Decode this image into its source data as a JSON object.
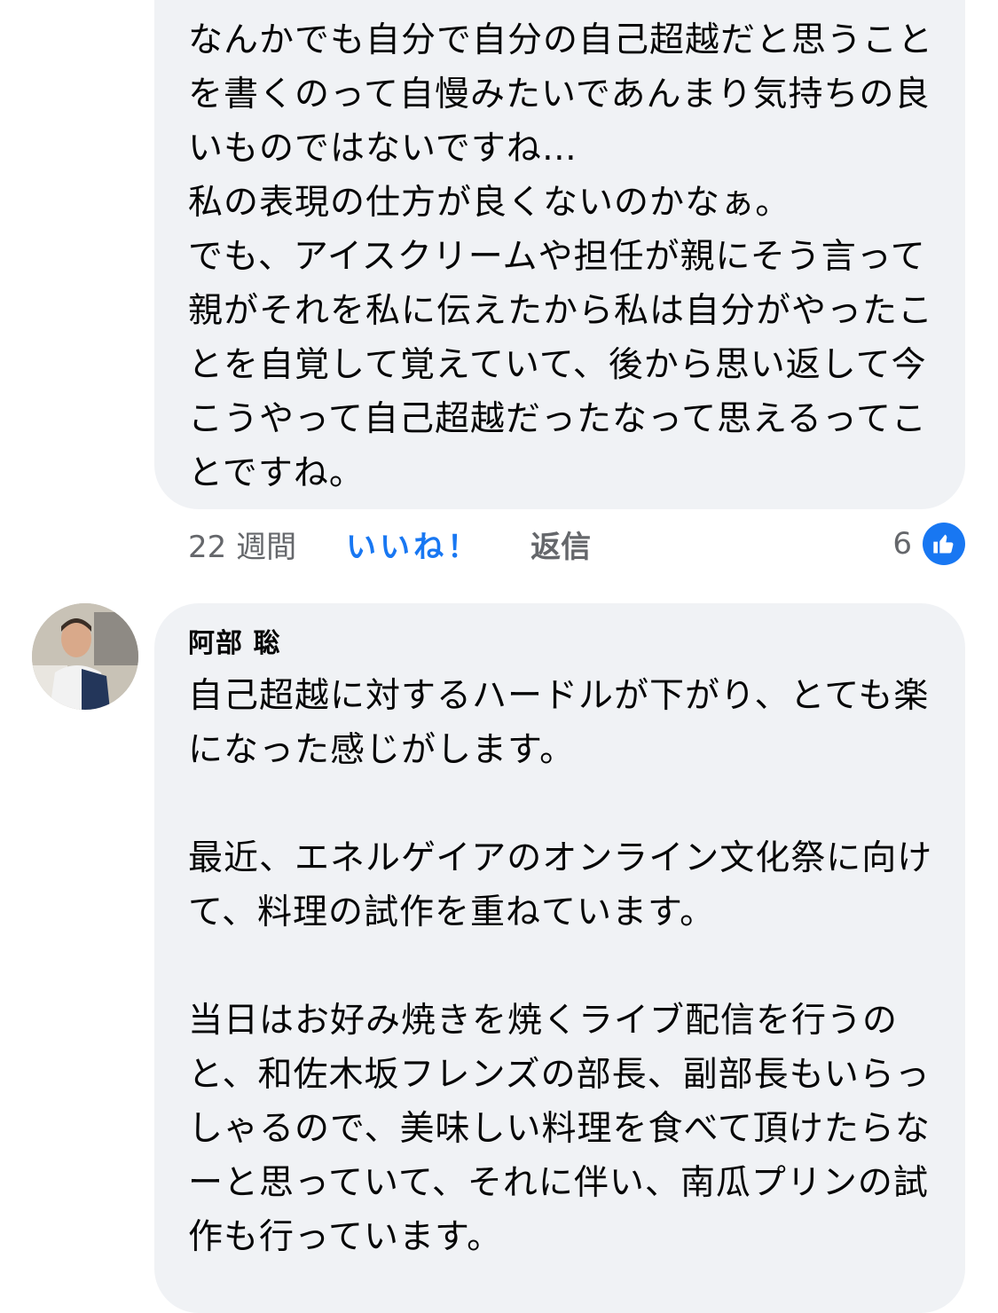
{
  "comments": [
    {
      "text": "なんかでも自分で自分の自己超越だと思うことを書くのって自慢みたいであんまり気持ちの良いものではないですね…\n私の表現の仕方が良くないのかなぁ。\nでも、アイスクリームや担任が親にそう言って親がそれを私に伝えたから私は自分がやったことを自覚して覚えていて、後から思い返して今こうやって自己超越だったなって思えるってことですね。",
      "time": "22 週間",
      "like_label": "いいね！",
      "reply_label": "返信",
      "reaction_count": "6",
      "reaction_icon": "thumbs-up-icon",
      "accent_color": "#1877f2"
    },
    {
      "author": "阿部 聡",
      "avatar_icon": "person-avatar",
      "text_1": "自己超越に対するハードルが下がり、とても楽になった感じがします。",
      "text_2": "最近、エネルゲイアのオンライン文化祭に向けて、料理の試作を重ねています。",
      "text_3": "当日はお好み焼きを焼くライブ配信を行うのと、和佐木坂フレンズの部長、副部長もいらっしゃるので、美味しい料理を食べて頂けたらなーと思っていて、それに伴い、南瓜プリンの試作も行っています。"
    }
  ]
}
